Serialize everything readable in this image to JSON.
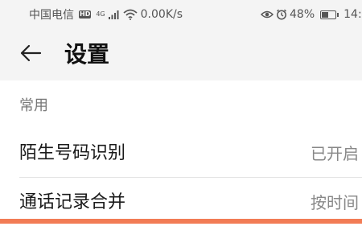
{
  "status_bar": {
    "carrier": "中国电信",
    "hd_badge": "HD",
    "network_type": "4G",
    "speed": "0.00K/s",
    "battery_percent": "48%",
    "battery_level": 0.48,
    "time": "14:"
  },
  "header": {
    "title": "设置"
  },
  "section": {
    "header": "常用",
    "items": [
      {
        "label": "陌生号码识别",
        "value": "已开启"
      },
      {
        "label": "通话记录合并",
        "value": "按时间"
      }
    ]
  },
  "colors": {
    "highlight": "#f27c55",
    "background": "#ffffff",
    "status_bar_bg": "#f4f4f4"
  },
  "icons": {
    "back": "arrow-left-icon",
    "signal": "signal-icon",
    "wifi": "wifi-icon",
    "eye": "eye-icon",
    "alarm": "alarm-icon",
    "battery": "battery-icon"
  }
}
